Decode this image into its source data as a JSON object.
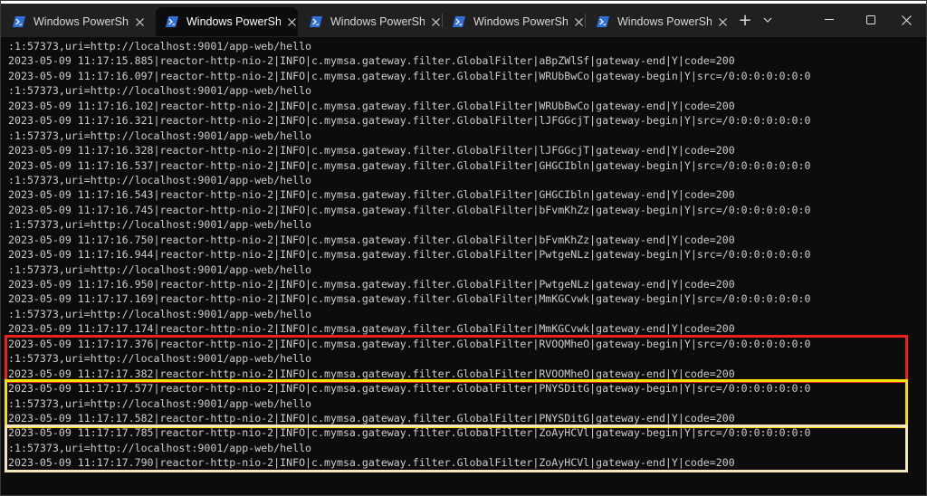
{
  "tabs": [
    {
      "label": "Windows PowerShe",
      "active": false
    },
    {
      "label": "Windows PowerShe",
      "active": true
    },
    {
      "label": "Windows PowerShe",
      "active": false
    },
    {
      "label": "Windows PowerShe",
      "active": false
    },
    {
      "label": "Windows PowerShe",
      "active": false
    }
  ],
  "titlebar": {
    "new_tab_glyph": "+",
    "dropdown_glyph": "⌄",
    "minimize_glyph": "—",
    "maximize_glyph": "☐",
    "close_glyph": "✕"
  },
  "console": {
    "lines": [
      ":1:57373,uri=http://localhost:9001/app-web/hello",
      "2023-05-09 11:17:15.885|reactor-http-nio-2|INFO|c.mymsa.gateway.filter.GlobalFilter|aBpZWlSf|gateway-end|Y|code=200",
      "2023-05-09 11:17:16.097|reactor-http-nio-2|INFO|c.mymsa.gateway.filter.GlobalFilter|WRUbBwCo|gateway-begin|Y|src=/0:0:0:0:0:0:0",
      ":1:57373,uri=http://localhost:9001/app-web/hello",
      "2023-05-09 11:17:16.102|reactor-http-nio-2|INFO|c.mymsa.gateway.filter.GlobalFilter|WRUbBwCo|gateway-end|Y|code=200",
      "2023-05-09 11:17:16.321|reactor-http-nio-2|INFO|c.mymsa.gateway.filter.GlobalFilter|lJFGGcjT|gateway-begin|Y|src=/0:0:0:0:0:0:0",
      ":1:57373,uri=http://localhost:9001/app-web/hello",
      "2023-05-09 11:17:16.328|reactor-http-nio-2|INFO|c.mymsa.gateway.filter.GlobalFilter|lJFGGcjT|gateway-end|Y|code=200",
      "2023-05-09 11:17:16.537|reactor-http-nio-2|INFO|c.mymsa.gateway.filter.GlobalFilter|GHGCIbln|gateway-begin|Y|src=/0:0:0:0:0:0:0",
      ":1:57373,uri=http://localhost:9001/app-web/hello",
      "2023-05-09 11:17:16.543|reactor-http-nio-2|INFO|c.mymsa.gateway.filter.GlobalFilter|GHGCIbln|gateway-end|Y|code=200",
      "2023-05-09 11:17:16.745|reactor-http-nio-2|INFO|c.mymsa.gateway.filter.GlobalFilter|bFvmKhZz|gateway-begin|Y|src=/0:0:0:0:0:0:0",
      ":1:57373,uri=http://localhost:9001/app-web/hello",
      "2023-05-09 11:17:16.750|reactor-http-nio-2|INFO|c.mymsa.gateway.filter.GlobalFilter|bFvmKhZz|gateway-end|Y|code=200",
      "2023-05-09 11:17:16.944|reactor-http-nio-2|INFO|c.mymsa.gateway.filter.GlobalFilter|PwtgeNLz|gateway-begin|Y|src=/0:0:0:0:0:0:0",
      ":1:57373,uri=http://localhost:9001/app-web/hello",
      "2023-05-09 11:17:16.950|reactor-http-nio-2|INFO|c.mymsa.gateway.filter.GlobalFilter|PwtgeNLz|gateway-end|Y|code=200",
      "2023-05-09 11:17:17.169|reactor-http-nio-2|INFO|c.mymsa.gateway.filter.GlobalFilter|MmKGCvwk|gateway-begin|Y|src=/0:0:0:0:0:0:0",
      ":1:57373,uri=http://localhost:9001/app-web/hello",
      "2023-05-09 11:17:17.174|reactor-http-nio-2|INFO|c.mymsa.gateway.filter.GlobalFilter|MmKGCvwk|gateway-end|Y|code=200",
      "2023-05-09 11:17:17.376|reactor-http-nio-2|INFO|c.mymsa.gateway.filter.GlobalFilter|RVOQMheO|gateway-begin|Y|src=/0:0:0:0:0:0:0",
      ":1:57373,uri=http://localhost:9001/app-web/hello",
      "2023-05-09 11:17:17.382|reactor-http-nio-2|INFO|c.mymsa.gateway.filter.GlobalFilter|RVOOMheO|gateway-end|Y|code=200",
      "2023-05-09 11:17:17.577|reactor-http-nio-2|INFO|c.mymsa.gateway.filter.GlobalFilter|PNYSDitG|gateway-begin|Y|src=/0:0:0:0:0:0:0",
      ":1:57373,uri=http://localhost:9001/app-web/hello",
      "2023-05-09 11:17:17.582|reactor-http-nio-2|INFO|c.mymsa.gateway.filter.GlobalFilter|PNYSDitG|gateway-end|Y|code=200",
      "2023-05-09 11:17:17.785|reactor-http-nio-2|INFO|c.mymsa.gateway.filter.GlobalFilter|ZoAyHCVl|gateway-begin|Y|src=/0:0:0:0:0:0:0",
      ":1:57373,uri=http://localhost:9001/app-web/hello",
      "2023-05-09 11:17:17.790|reactor-http-nio-2|INFO|c.mymsa.gateway.filter.GlobalFilter|ZoAyHCVl|gateway-end|Y|code=200"
    ]
  },
  "highlights": [
    {
      "first_line": 20,
      "line_count": 3,
      "color": "#e8231e"
    },
    {
      "first_line": 23,
      "line_count": 3,
      "color": "#f5e10a"
    },
    {
      "first_line": 26,
      "line_count": 3,
      "color": "#f3e6bd"
    }
  ],
  "colors": {
    "terminal_bg": "#0c0c0c",
    "terminal_text": "#cccccc",
    "titlebar_bg": "#202020"
  }
}
